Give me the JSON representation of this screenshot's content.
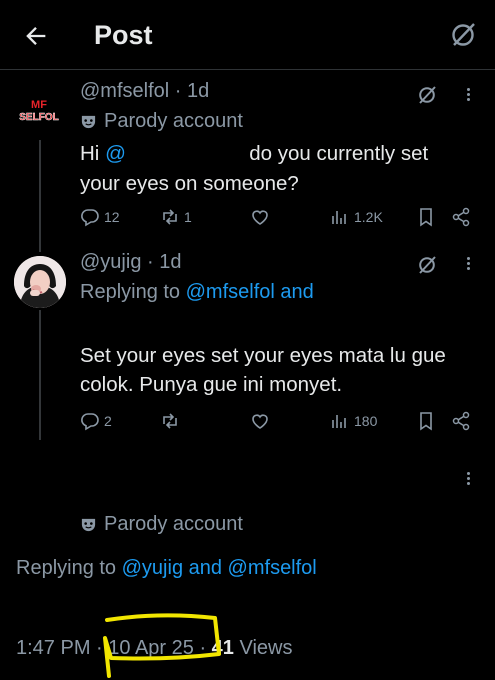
{
  "header": {
    "title": "Post"
  },
  "tweet1": {
    "handle": "@mfselfol",
    "time": "1d",
    "badge": "Parody account",
    "text_hi": "Hi",
    "text_mention": "@",
    "text_rest1": "do you currently set",
    "text_rest2": "your eyes on someone?",
    "avatar_text": "MF SELFOL",
    "replies": "12",
    "reposts": "1",
    "likes": "",
    "views": "1.2K"
  },
  "tweet2": {
    "handle": "@yujig",
    "time": "1d",
    "replying_prefix": "Replying to",
    "replying_to": "@mfselfol and",
    "text_line1": "Set your eyes set your eyes mata lu gue",
    "text_line2": "colok. Punya gue ini monyet.",
    "replies": "2",
    "reposts": "",
    "likes": "",
    "views": "180"
  },
  "main": {
    "badge": "Parody account",
    "replying_prefix": "Replying to",
    "replying_to": "@yujig and @mfselfol",
    "time": "1:47 PM",
    "date": "10 Apr 25",
    "views_count": "41",
    "views_label": "Views"
  },
  "colors": {
    "accent": "#1d9bf0",
    "muted": "#8b98a5",
    "text": "#e7e9ea",
    "highlight": "#f2e600"
  }
}
